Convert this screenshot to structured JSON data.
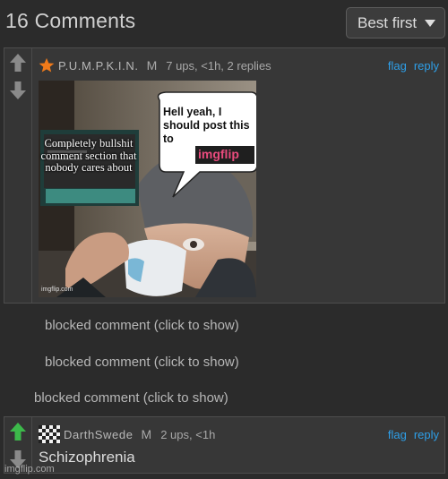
{
  "header": {
    "comment_count": "16 Comments",
    "sort_label": "Best first",
    "sort_icon": "chevron-down-icon"
  },
  "comments": [
    {
      "author": "P.U.M.P.K.I.N.",
      "mod_badge": "M",
      "stats": "7 ups, <1h, 2 replies",
      "flag": "flag",
      "reply": "reply",
      "avatar_icon": "star-icon",
      "avatar_color": "#f07a1a",
      "image": {
        "speech_bubble": "Hell yeah, I should post this to",
        "brand_logo": "imgflip",
        "overlay_caption": "Completely bullshit comment section that nobody cares about",
        "watermark": "imgflip.com"
      }
    },
    {
      "author": "DarthSwede",
      "mod_badge": "M",
      "stats": "2 ups, <1h",
      "flag": "flag",
      "reply": "reply",
      "avatar_icon": "checkered-avatar-icon",
      "text": "Schizophrenia",
      "upvoted": true
    }
  ],
  "blocked": [
    "blocked comment (click to show)",
    "blocked comment (click to show)",
    "blocked comment (click to show)"
  ],
  "footer_watermark": "imgflip.com",
  "colors": {
    "background": "#2b2b2b",
    "panel": "#373737",
    "link": "#2e9fe8",
    "upvote_active": "#3cb94a",
    "vote_default": "#8a8a8a"
  }
}
